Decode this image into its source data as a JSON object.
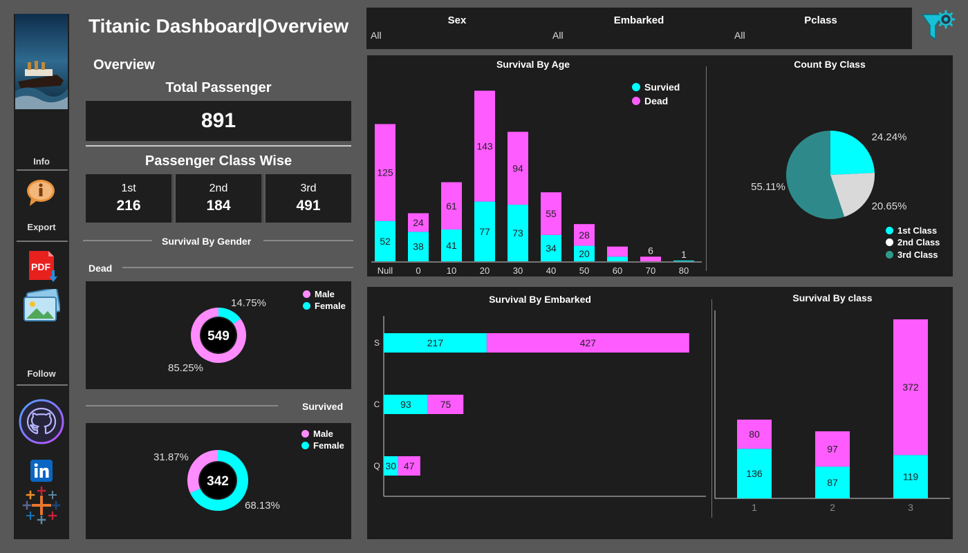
{
  "title": "Titanic Dashboard|Overview",
  "sidebar": {
    "info_label": "Info",
    "export_label": "Export",
    "follow_label": "Follow",
    "pdf_text": "PDF"
  },
  "overview": {
    "heading": "Overview",
    "total_heading": "Total Passenger",
    "total_value": "891",
    "class_heading": "Passenger Class Wise",
    "classes": [
      {
        "label": "1st",
        "value": "216"
      },
      {
        "label": "2nd",
        "value": "184"
      },
      {
        "label": "3rd",
        "value": "491"
      }
    ]
  },
  "gender": {
    "title": "Survival By Gender",
    "dead_label": "Dead",
    "survived_label": "Survived",
    "legend": [
      "Male",
      "Female"
    ],
    "dead": {
      "total": "549",
      "male_pct": "85.25%",
      "female_pct": "14.75%",
      "male": 0.8525
    },
    "survived": {
      "total": "342",
      "male_pct": "31.87%",
      "female_pct": "68.13%",
      "male": 0.3187
    }
  },
  "filters": [
    {
      "name": "Sex",
      "value": "All"
    },
    {
      "name": "Embarked",
      "value": "All"
    },
    {
      "name": "Pclass",
      "value": "All"
    }
  ],
  "colors": {
    "survived": "#00ffff",
    "dead": "#ff5cff",
    "first": "#00ffff",
    "second": "#d9d9d9",
    "third": "#2e8a8a"
  },
  "chart_data": [
    {
      "type": "bar",
      "title": "Survival By Age",
      "categories": [
        "Null",
        "0",
        "10",
        "20",
        "30",
        "40",
        "50",
        "60",
        "70",
        "80"
      ],
      "series": [
        {
          "name": "Survied",
          "values": [
            52,
            38,
            41,
            77,
            73,
            34,
            20,
            6,
            0,
            1
          ]
        },
        {
          "name": "Dead",
          "values": [
            125,
            24,
            61,
            143,
            94,
            55,
            28,
            13,
            6,
            0
          ]
        }
      ],
      "labels": {
        "survived": [
          "52",
          "38",
          "41",
          "77",
          "73",
          "34",
          "20",
          "",
          "",
          ""
        ],
        "dead": [
          "125",
          "24",
          "61",
          "143",
          "94",
          "55",
          "28",
          "",
          "6",
          "1"
        ]
      },
      "stacked": true,
      "ylim": [
        0,
        230
      ]
    },
    {
      "type": "pie",
      "title": "Count  By Class",
      "labels": [
        "1st Class",
        "2nd Class",
        "3rd Class"
      ],
      "values": [
        24.24,
        20.65,
        55.11
      ],
      "value_labels": [
        "24.24%",
        "20.65%",
        "55.11%"
      ]
    },
    {
      "type": "bar",
      "orientation": "horizontal",
      "title": "Survival By Embarked",
      "categories": [
        "S",
        "C",
        "Q"
      ],
      "series": [
        {
          "name": "Survived",
          "values": [
            217,
            93,
            30
          ]
        },
        {
          "name": "Dead",
          "values": [
            427,
            75,
            47
          ]
        }
      ],
      "stacked": true,
      "xlim": [
        0,
        700
      ]
    },
    {
      "type": "bar",
      "title": "Survival By class",
      "categories": [
        "1",
        "2",
        "3"
      ],
      "series": [
        {
          "name": "Survived",
          "values": [
            136,
            87,
            119
          ]
        },
        {
          "name": "Dead",
          "values": [
            80,
            97,
            372
          ]
        }
      ],
      "stacked": true,
      "ylim": [
        0,
        530
      ]
    }
  ]
}
